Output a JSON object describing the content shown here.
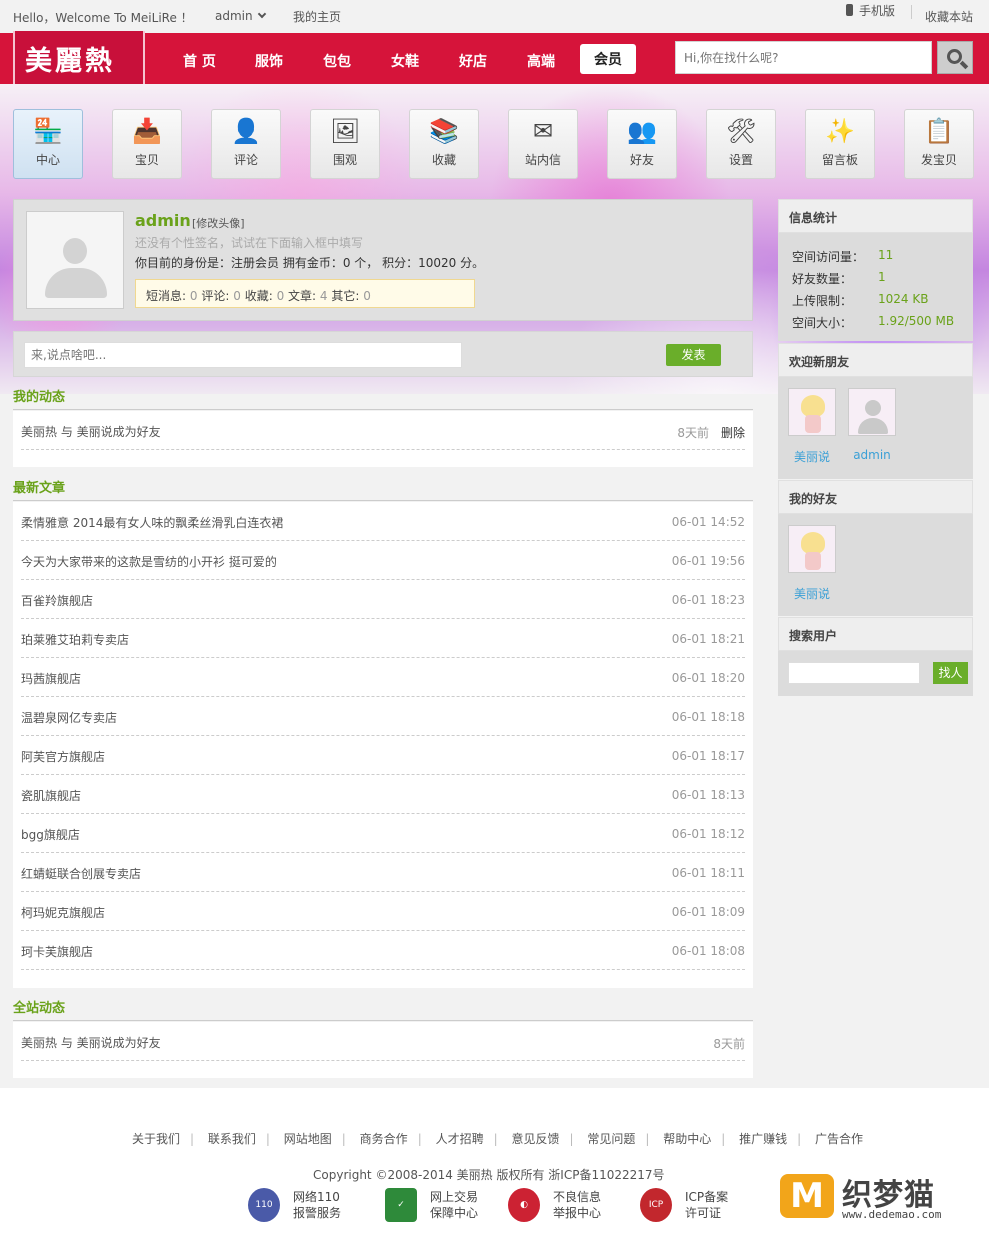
{
  "topbar": {
    "greeting": "Hello，Welcome To MeiLiRe ！",
    "username": "admin",
    "my_home": "我的主页",
    "mobile": "手机版",
    "bookmark": "收藏本站"
  },
  "header": {
    "logo": "美麗熱",
    "nav": [
      "首 页",
      "服饰",
      "包包",
      "女鞋",
      "好店",
      "高端",
      "会员"
    ],
    "active_nav": "会员",
    "search_placeholder": "Hi,你在找什么呢?"
  },
  "tiles": [
    {
      "label": "中心",
      "icon": "shop-icon"
    },
    {
      "label": "宝贝",
      "icon": "inbox-tray-icon"
    },
    {
      "label": "评论",
      "icon": "user-person-icon"
    },
    {
      "label": "围观",
      "icon": "easel-picture-icon"
    },
    {
      "label": "收藏",
      "icon": "bookshelf-icon"
    },
    {
      "label": "站内信",
      "icon": "envelope-icon"
    },
    {
      "label": "好友",
      "icon": "friends-icon"
    },
    {
      "label": "设置",
      "icon": "tools-icon"
    },
    {
      "label": "留言板",
      "icon": "magic-wand-icon"
    },
    {
      "label": "发宝贝",
      "icon": "clipboard-icon"
    }
  ],
  "profile": {
    "name": "admin",
    "modify_avatar": "[修改头像]",
    "signature": "还没有个性签名，试试在下面输入框中填写",
    "identity": "你目前的身份是：注册会员 拥有金币：0 个， 积分：10020 分。",
    "stats": [
      {
        "label": "短消息:",
        "value": "0"
      },
      {
        "label": "评论:",
        "value": "0"
      },
      {
        "label": "收藏:",
        "value": "0"
      },
      {
        "label": "文章:",
        "value": "4"
      },
      {
        "label": "其它:",
        "value": "0"
      }
    ]
  },
  "post": {
    "placeholder": "来,说点啥吧...",
    "button": "发表"
  },
  "my_feed": {
    "title": "我的动态",
    "items": [
      {
        "text": "美丽热 与 美丽说成为好友",
        "ago": "8天前",
        "action": "删除"
      }
    ]
  },
  "latest": {
    "title": "最新文章",
    "items": [
      {
        "title": "柔情雅意 2014最有女人味的飘柔丝滑乳白连衣裙",
        "date": "06-01 14:52"
      },
      {
        "title": "今天为大家带来的这款是雪纺的小开衫 挺可爱的",
        "date": "06-01 19:56"
      },
      {
        "title": "百雀羚旗舰店",
        "date": "06-01 18:23"
      },
      {
        "title": "珀莱雅艾珀莉专卖店",
        "date": "06-01 18:21"
      },
      {
        "title": "玛茜旗舰店",
        "date": "06-01 18:20"
      },
      {
        "title": "温碧泉网亿专卖店",
        "date": "06-01 18:18"
      },
      {
        "title": "阿芙官方旗舰店",
        "date": "06-01 18:17"
      },
      {
        "title": "瓷肌旗舰店",
        "date": "06-01 18:13"
      },
      {
        "title": "bgg旗舰店",
        "date": "06-01 18:12"
      },
      {
        "title": "红蜻蜓联合创展专卖店",
        "date": "06-01 18:11"
      },
      {
        "title": "柯玛妮克旗舰店",
        "date": "06-01 18:09"
      },
      {
        "title": "珂卡芙旗舰店",
        "date": "06-01 18:08"
      }
    ]
  },
  "site_feed": {
    "title": "全站动态",
    "items": [
      {
        "text": "美丽热 与 美丽说成为好友",
        "ago": "8天前"
      }
    ]
  },
  "sidebar": {
    "info_title": "信息统计",
    "info": [
      {
        "label": "空间访问量：",
        "value": "11"
      },
      {
        "label": "好友数量：",
        "value": "1"
      },
      {
        "label": "上传限制：",
        "value": "1024 KB"
      },
      {
        "label": "空间大小：",
        "value": "1.92/500 MB"
      }
    ],
    "new_friends_title": "欢迎新朋友",
    "new_friends": [
      "美丽说",
      "admin"
    ],
    "my_friends_title": "我的好友",
    "my_friends": [
      "美丽说"
    ],
    "search_title": "搜索用户",
    "search_button": "找人"
  },
  "footer": {
    "links": [
      "关于我们",
      "联系我们",
      "网站地图",
      "商务合作",
      "人才招聘",
      "意见反馈",
      "常见问题",
      "帮助中心",
      "推广赚钱",
      "广告合作"
    ],
    "copyright": "Copyright ©2008-2014   美丽热   版权所有   浙ICP备11022217号",
    "badges": [
      {
        "line1": "网络110",
        "line2": "报警服务",
        "color": "#4a5aa8"
      },
      {
        "line1": "网上交易",
        "line2": "保障中心",
        "color": "#2e8a3a"
      },
      {
        "line1": "不良信息",
        "line2": "举报中心",
        "color": "#cc2233"
      },
      {
        "line1": "ICP备案",
        "line2": "许可证",
        "color": "#c2272d"
      }
    ],
    "watermark_text": "织梦猫",
    "watermark_url": "www.dedemao.com",
    "watermark_color": "#f2a51a"
  }
}
